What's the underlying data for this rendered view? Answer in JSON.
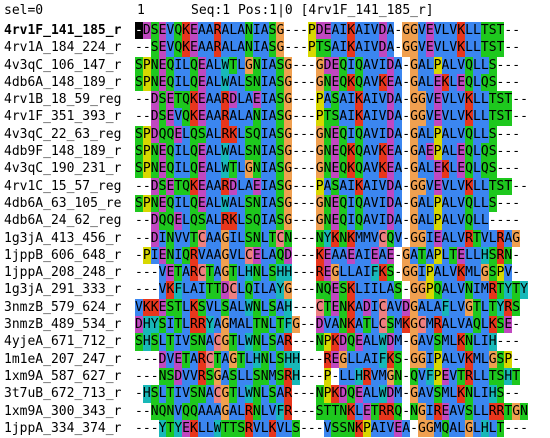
{
  "header": {
    "sel_text": "sel=0",
    "ruler_text": "1",
    "status_text": "Seq:1 Pos:1|0 [4rv1F_141_185_r]"
  },
  "cursor": {
    "row": 0,
    "col": 0
  },
  "colors": {
    "hydrophobic": "#3b86f0",
    "positive": "#e8361c",
    "negative": "#c048c0",
    "polar": "#1ec81e",
    "cysteine": "#ee8080",
    "glycine": "#f0a050",
    "proline": "#d8d800",
    "aromatic": "#18b8b8",
    "gap": "#ffffff"
  },
  "sequences": [
    {
      "name": "4rv1F_141_185_r",
      "bold": true,
      "seq": "-DSEVQKEAARALANIASG---PDEAIKAIVDA-GGVEVLVKLLTST--"
    },
    {
      "name": "4rv1A_184_224_r",
      "bold": false,
      "seq": "--SEVQKEAARALANIASG---PTSAIKAIVDA-GGVEVLVKLLTST--"
    },
    {
      "name": "4v3qC_106_147_r",
      "bold": false,
      "seq": "SPNEQILQEALWTLGNIASG---GDEQIQAVIDA-GALPALVQLLS---"
    },
    {
      "name": "4db6A_148_189_r",
      "bold": false,
      "seq": "SPNEQILQEALWALSNIASG---GNEQKQAVKEA-GALEKLEQLQS---"
    },
    {
      "name": "4rv1B_18_59_reg",
      "bold": false,
      "seq": "--DSETQKEAARDLAEIASG---PASAIKAIVDA-GGVEVLVKLLTST--"
    },
    {
      "name": "4rv1F_351_393_r",
      "bold": false,
      "seq": "--DSEVQKEAARALANIASG---PTSAIKAIVDA-GGVEVLVKLLTST--"
    },
    {
      "name": "4v3qC_22_63_reg",
      "bold": false,
      "seq": "SPDQQELQSALRKLSQIASG---GNEQIQAVIDA-GALPALVQLLS---"
    },
    {
      "name": "4db9F_148_189_r",
      "bold": false,
      "seq": "SPNEQILQEALWALSNIASG---GNEQKQAVKEA-GAEPALEQLQS---"
    },
    {
      "name": "4v3qC_190_231_r",
      "bold": false,
      "seq": "SPNEQILQEALWTLGNIASG---GNEQKQAVKEA-GALEKLEQLQS---"
    },
    {
      "name": "4rv1C_15_57_reg",
      "bold": false,
      "seq": "--DSETQKEAARDLAEIASG---PASAIKAIVDA-GGVEVLVKLLTST--"
    },
    {
      "name": "4db6A_63_105_re",
      "bold": false,
      "seq": "SPNEQILQEALWALSNIASG---GNEQIQAVIDA-GALPALVQLLS---"
    },
    {
      "name": "4db6A_24_62_reg",
      "bold": false,
      "seq": "--DQQELQSALRKLSQIASG---GNEQIQAVIDA-GALPALVQLL----"
    },
    {
      "name": "1g3jA_413_456_r",
      "bold": false,
      "seq": "--DINVVTCAAGILSNLTCN---NYKNKMMVCQV-GGIEALVRTVLRAG"
    },
    {
      "name": "1jppB_606_648_r",
      "bold": false,
      "seq": "-PIENIQRVAAGVLCELAQD---KEAAEAIEAE-GATAPLTELLHSRN-"
    },
    {
      "name": "1jppA_208_248_r",
      "bold": false,
      "seq": "---VETARCTAGTLHNLSHH---REGLLAIFKS-GGIPALVKMLGSPV-"
    },
    {
      "name": "1g3jA_291_333_r",
      "bold": false,
      "seq": "---VKFLAITTDCLQILAYG---NQESKLIILAS-GGPQALVNIMRTYTY"
    },
    {
      "name": "3nmzB_579_624_r",
      "bold": false,
      "seq": "VKKESTLKSVLSALWNLSAH---CTENKADICAVDGALAFLVGTLTYRS"
    },
    {
      "name": "3nmzB_489_534_r",
      "bold": false,
      "seq": "DHYSITLRRYAGMALTNLTFG--DVANKATLCSMKGCMRALVAQLKSE-"
    },
    {
      "name": "4yjeA_671_712_r",
      "bold": false,
      "seq": "SHSLTIVSNACGTLWNLSAR---NPKDQEALWDM-GAVSMLKNLIH---"
    },
    {
      "name": "1m1eA_207_247_r",
      "bold": false,
      "seq": "---DVETARCTAGTLHNLSHH---REGLLAIFKS-GGIPALVKMLGSP-"
    },
    {
      "name": "1xm9A_587_627_r",
      "bold": false,
      "seq": "---NSDVVRSGASLLSNMSRH---P-LLHRVMGN-QVFPEVTRLLTSHT"
    },
    {
      "name": "3t7uB_672_713_r",
      "bold": false,
      "seq": "-HSLTIVSNACGTLWNLSAR---NPKDQEALWDM-GAVSMLKNLIHS--"
    },
    {
      "name": "1xm9A_300_343_r",
      "bold": false,
      "seq": "--NQNVQQAAAGALRNLVFR---STTNKLETRRQ-NGIREAVSLLRRTGN"
    },
    {
      "name": "1jppA_334_374_r",
      "bold": false,
      "seq": "---YTYEKLLWTTSRVLKVLS---VSSNKPAIVEA-GGMQALGLHLT---"
    }
  ]
}
